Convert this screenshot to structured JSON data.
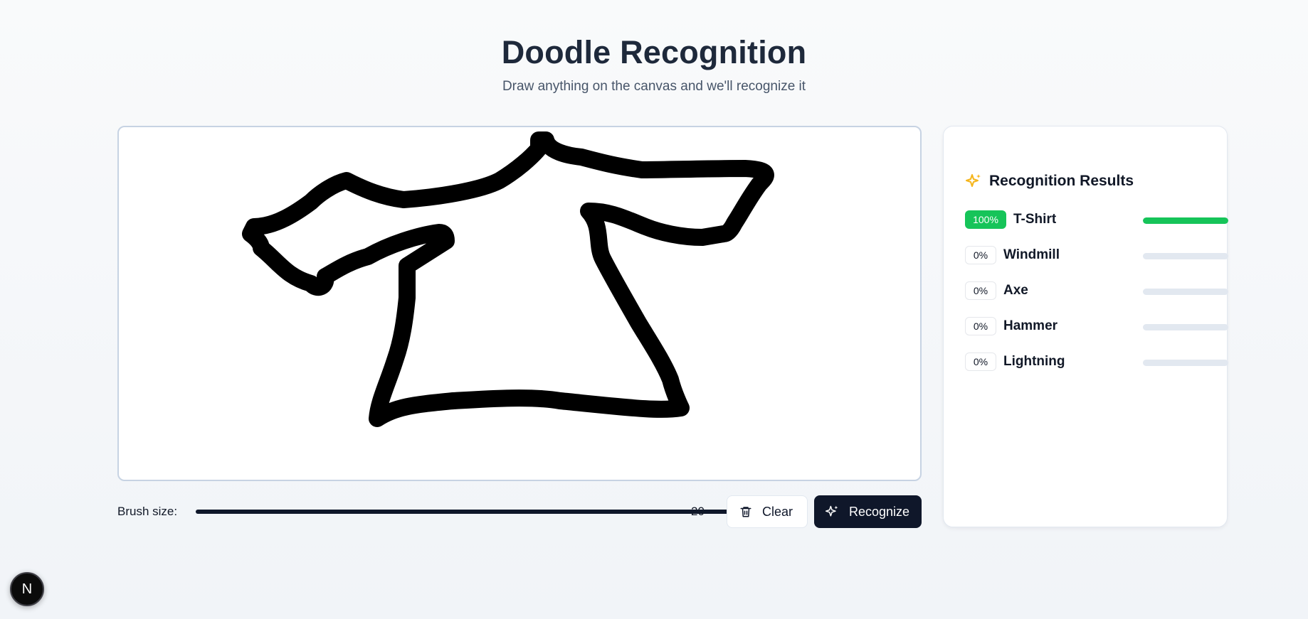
{
  "header": {
    "title": "Doodle Recognition",
    "subtitle": "Draw anything on the canvas and we'll recognize it"
  },
  "canvas": {
    "stroke_color": "#000000",
    "drawing_icon": "tshirt-doodle"
  },
  "controls": {
    "brush_label": "Brush size:",
    "brush_value": "20",
    "brush_fraction": 1.0,
    "clear_label": "Clear",
    "clear_icon": "trash-icon",
    "recognize_label": "Recognize",
    "recognize_icon": "sparkles-icon"
  },
  "results": {
    "title": "Recognition Results",
    "icon": "sparkles-icon",
    "accent_color": "#f5b51b",
    "items": [
      {
        "percent": "100%",
        "label": "T-Shirt",
        "fraction": 1.0
      },
      {
        "percent": "0%",
        "label": "Windmill",
        "fraction": 0
      },
      {
        "percent": "0%",
        "label": "Axe",
        "fraction": 0
      },
      {
        "percent": "0%",
        "label": "Hammer",
        "fraction": 0
      },
      {
        "percent": "0%",
        "label": "Lightning",
        "fraction": 0
      }
    ]
  },
  "badge": {
    "letter": "N"
  },
  "colors": {
    "primary": "#0f172a",
    "success": "#16c459",
    "track": "#e2e8f0"
  }
}
